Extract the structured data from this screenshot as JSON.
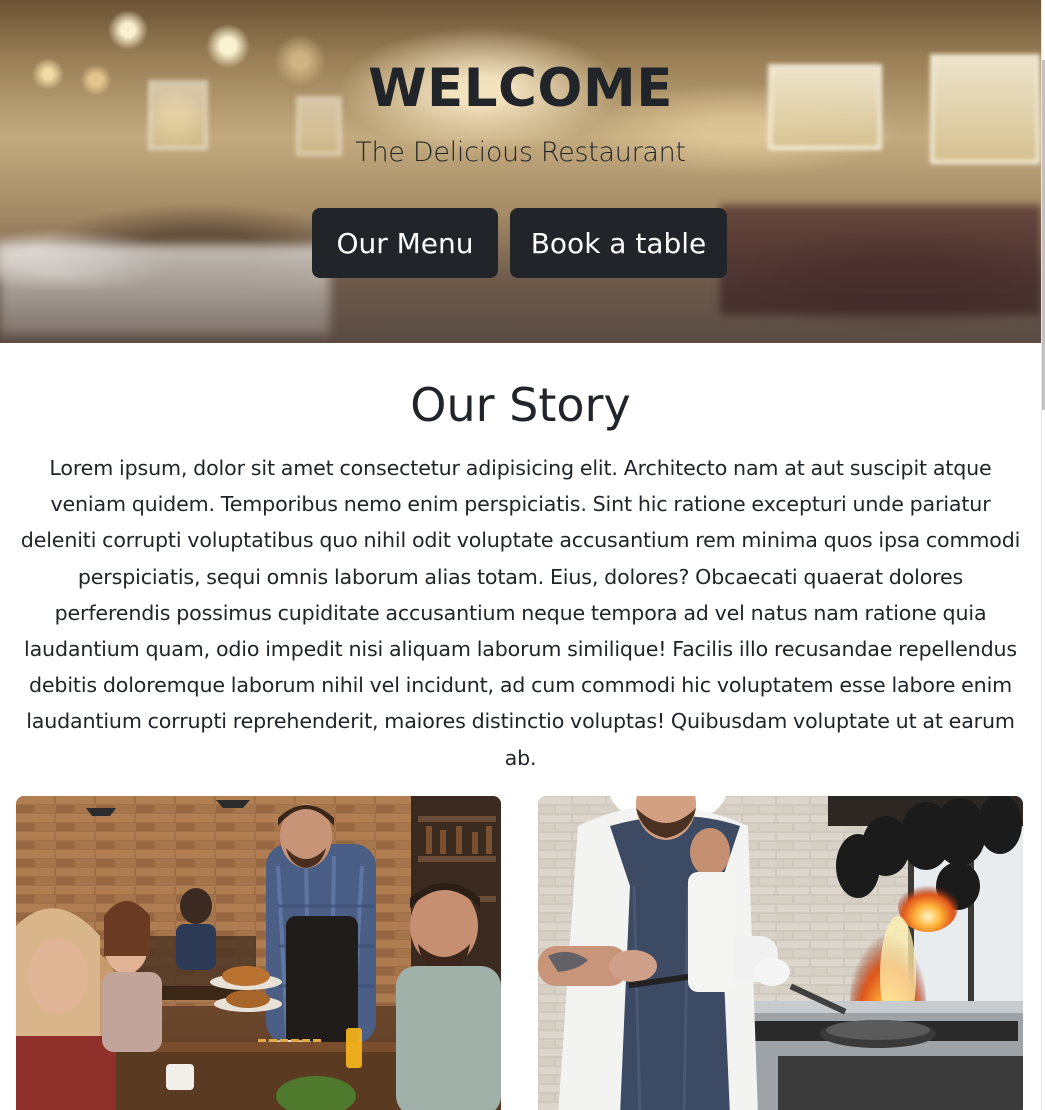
{
  "hero": {
    "title": "WELCOME",
    "subtitle": "The Delicious Restaurant",
    "buttons": {
      "menu_label": "Our Menu",
      "book_label": "Book a table"
    }
  },
  "story": {
    "title": "Our Story",
    "text": "Lorem ipsum, dolor sit amet consectetur adipisicing elit. Architecto nam at aut suscipit atque veniam quidem. Temporibus nemo enim perspiciatis. Sint hic ratione excepturi unde pariatur deleniti corrupti voluptatibus quo nihil odit voluptate accusantium rem minima quos ipsa commodi perspiciatis, sequi omnis laborum alias totam. Eius, dolores? Obcaecati quaerat dolores perferendis possimus cupiditate accusantium neque tempora ad vel natus nam ratione quia laudantium quam, odio impedit nisi aliquam laborum similique! Facilis illo recusandae repellendus debitis doloremque laborum nihil vel incidunt, ad cum commodi hic voluptatem esse labore enim laudantium corrupti reprehenderit, maiores distinctio voluptas! Quibusdam voluptate ut at earum ab."
  },
  "colors": {
    "dark": "#212529",
    "button_text": "#ffffff",
    "background": "#ffffff"
  }
}
